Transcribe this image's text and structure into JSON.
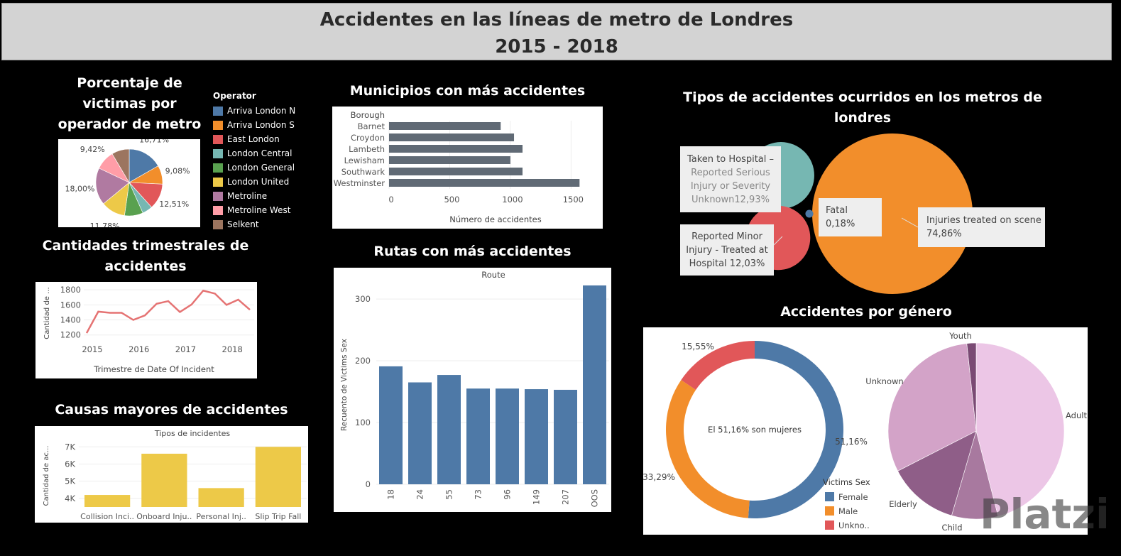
{
  "header": {
    "title_line1": "Accidentes en las líneas de metro de Londres",
    "title_line2": "2015 - 2018"
  },
  "titles": {
    "pie_operator": [
      "Porcentaje de",
      "victimas por",
      "operador de metro"
    ],
    "quarterly": [
      "Cantidades trimestrales de",
      "accidentes"
    ],
    "causes": "Causas mayores de accidentes",
    "boroughs": "Municipios con más accidentes",
    "routes": "Rutas con más accidentes",
    "types": [
      "Tipos de accidentes ocurridos en los metros de",
      "londres"
    ],
    "gender": "Accidentes por género"
  },
  "watermark": "Platzi",
  "legend_operator": {
    "title": "Operator",
    "items": [
      {
        "label": "Arriva London N",
        "color": "#4e79a7"
      },
      {
        "label": "Arriva London S",
        "color": "#f28e2b"
      },
      {
        "label": "East London",
        "color": "#e15759"
      },
      {
        "label": "London Central",
        "color": "#76b7b2"
      },
      {
        "label": "London General",
        "color": "#59a14f"
      },
      {
        "label": "London United",
        "color": "#edc948"
      },
      {
        "label": "Metroline",
        "color": "#b07aa1"
      },
      {
        "label": "Metroline West",
        "color": "#ff9da7"
      },
      {
        "label": "Selkent",
        "color": "#9c755f"
      }
    ]
  },
  "legend_gender": {
    "title": "Victims Sex",
    "items": [
      {
        "label": "Female",
        "color": "#4e79a7"
      },
      {
        "label": "Male",
        "color": "#f28e2b"
      },
      {
        "label": "Unkno..",
        "color": "#e15759"
      }
    ]
  },
  "type_callouts": {
    "hospital_serious": [
      "Taken to Hospital –",
      "Reported Serious",
      "Injury or Severity",
      "Unknown12,93%"
    ],
    "minor_hospital": [
      "Reported Minor",
      "Injury - Treated at",
      "Hospital  12,03%"
    ],
    "fatal": [
      "Fatal",
      "0,18%"
    ],
    "scene": [
      "Injuries treated on scene",
      "74,86%"
    ]
  },
  "chart_data": [
    {
      "type": "pie",
      "name": "operator_share",
      "labels": [
        "Arriva London N",
        "Arriva London S",
        "East London",
        "London Central",
        "London General",
        "London United",
        "Metroline",
        "Metroline West",
        "Selkent"
      ],
      "values": [
        16.71,
        9.08,
        12.51,
        5.0,
        8.97,
        11.78,
        18.0,
        9.42,
        8.53
      ],
      "data_labels": [
        "16,71%",
        "9,08%",
        "12,51%",
        "",
        "8,97%",
        "11,78%",
        "18,00%",
        "9,42%",
        ""
      ],
      "colors": [
        "#4e79a7",
        "#f28e2b",
        "#e15759",
        "#76b7b2",
        "#59a14f",
        "#edc948",
        "#b07aa1",
        "#ff9da7",
        "#9c755f"
      ]
    },
    {
      "type": "line",
      "name": "quarterly",
      "x": [
        "2015 Q1",
        "2015 Q2",
        "2015 Q3",
        "2015 Q4",
        "2016 Q1",
        "2016 Q2",
        "2016 Q3",
        "2016 Q4",
        "2017 Q1",
        "2017 Q2",
        "2017 Q3",
        "2017 Q4",
        "2018 Q1",
        "2018 Q2",
        "2018 Q3"
      ],
      "values": [
        1225,
        1510,
        1495,
        1495,
        1400,
        1460,
        1615,
        1650,
        1505,
        1605,
        1790,
        1750,
        1600,
        1670,
        1535
      ],
      "xticks": [
        "2015",
        "2016",
        "2017",
        "2018"
      ],
      "yticks": [
        1200,
        1400,
        1600,
        1800
      ],
      "ylim": [
        1150,
        1830
      ],
      "xlabel": "Trimestre de Date Of Incident",
      "ylabel": "Cantidad de ...",
      "color": "#e57373"
    },
    {
      "type": "bar",
      "name": "causes",
      "header": "Tipos de incidentes",
      "categories": [
        "Collision Inci..",
        "Onboard Inju..",
        "Personal Inj..",
        "Slip Trip Fall"
      ],
      "values": [
        4200,
        6600,
        4600,
        7000
      ],
      "yticks": [
        "4K",
        "5K",
        "6K",
        "7K"
      ],
      "ytick_values": [
        4000,
        5000,
        6000,
        7000
      ],
      "ylim": [
        3500,
        7300
      ],
      "ylabel": "Cantidad de ac...",
      "color": "#edc948"
    },
    {
      "type": "bar",
      "name": "boroughs",
      "orientation": "horizontal",
      "header": "Borough",
      "categories": [
        "Barnet",
        "Croydon",
        "Lambeth",
        "Lewisham",
        "Southwark",
        "Westminster"
      ],
      "values": [
        920,
        1030,
        1100,
        1000,
        1100,
        1570
      ],
      "xticks": [
        0,
        500,
        1000,
        1500
      ],
      "xlim": [
        0,
        1650
      ],
      "xlabel": "Número de accidentes",
      "color": "#606a75"
    },
    {
      "type": "bar",
      "name": "routes",
      "header": "Route",
      "categories": [
        "18",
        "24",
        "55",
        "73",
        "96",
        "149",
        "207",
        "OOS"
      ],
      "values": [
        191,
        165,
        177,
        155,
        155,
        154,
        153,
        322
      ],
      "yticks": [
        0,
        100,
        200,
        300
      ],
      "ylim": [
        0,
        330
      ],
      "ylabel": "Recuento de Victims Sex",
      "color": "#4e79a7"
    },
    {
      "type": "scatter",
      "name": "accident_types_bubbles",
      "labels": [
        "Injuries treated on scene",
        "Taken to Hospital – Reported Serious Injury or Severity Unknown",
        "Reported Minor Injury - Treated at Hospital",
        "Fatal"
      ],
      "values": [
        74.86,
        12.93,
        12.03,
        0.18
      ],
      "colors": [
        "#f28e2b",
        "#76b7b2",
        "#e15759",
        "#4e79a7"
      ]
    },
    {
      "type": "pie",
      "name": "gender_donut",
      "labels": [
        "Female",
        "Male",
        "Unkno.."
      ],
      "values": [
        51.16,
        33.29,
        15.55
      ],
      "data_labels": [
        "51,16%",
        "33,29%",
        "15,55%"
      ],
      "center_text": "El 51,16% son mujeres",
      "colors": [
        "#4e79a7",
        "#f28e2b",
        "#e15759"
      ]
    },
    {
      "type": "pie",
      "name": "age_pie",
      "labels": [
        "Adult",
        "Child",
        "Elderly",
        "Unknown",
        "Youth"
      ],
      "values": [
        46.0,
        8.5,
        13.0,
        30.8,
        1.7
      ],
      "colors": [
        "#ecc6e6",
        "#a8799f",
        "#8f5e88",
        "#d3a3c8",
        "#7a4a74"
      ]
    }
  ]
}
